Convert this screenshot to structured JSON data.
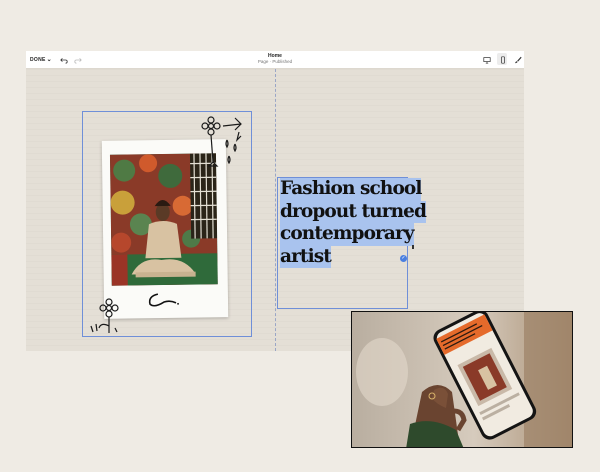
{
  "toolbar": {
    "done_label": "DONE",
    "page_title": "Home",
    "page_status": "Page · Published",
    "icons": [
      "undo-icon",
      "redo-icon",
      "desktop-icon",
      "mobile-icon",
      "brush-icon"
    ]
  },
  "text_block": {
    "lines": [
      "Fashion school",
      "dropout turned",
      "contemporary",
      "artist"
    ]
  },
  "colors": {
    "selection": "#a9c3ee",
    "block_border": "#6f8fd8",
    "canvas": "#e4dfd6",
    "phone_banner": "#e56a2b"
  }
}
